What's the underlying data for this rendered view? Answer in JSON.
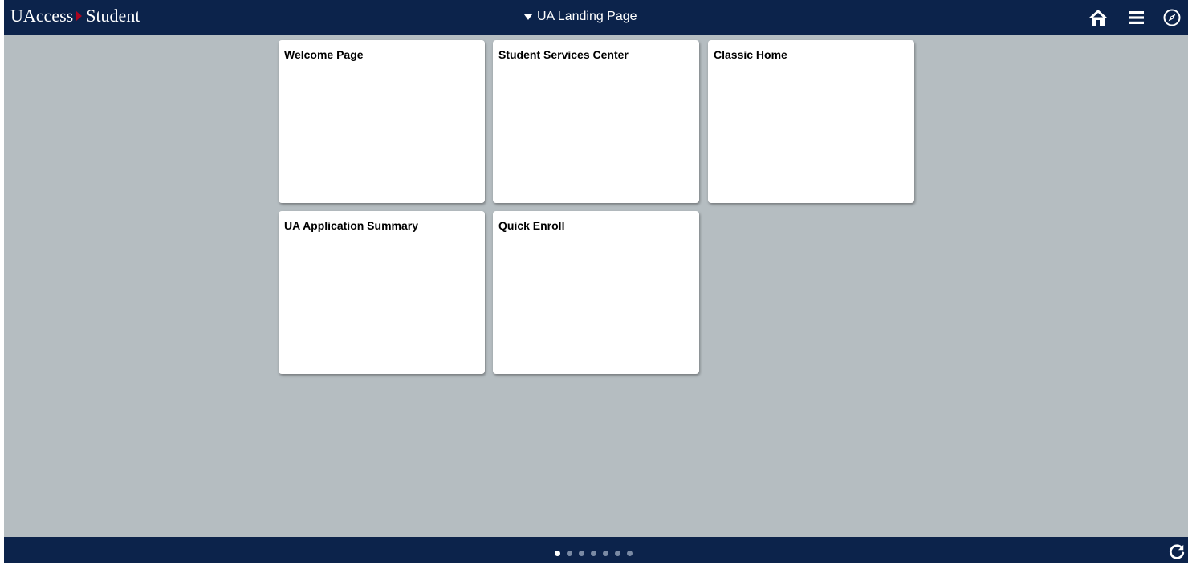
{
  "header": {
    "brand_part1": "UAccess",
    "brand_part2": "Student",
    "page_title": "UA Landing Page",
    "icons": [
      "home-icon",
      "menu-icon",
      "compass-icon"
    ]
  },
  "tiles": [
    {
      "title": "Welcome Page"
    },
    {
      "title": "Student Services Center"
    },
    {
      "title": "Classic Home"
    },
    {
      "title": "UA Application Summary"
    },
    {
      "title": "Quick Enroll"
    }
  ],
  "footer": {
    "page_dots_total": 7,
    "active_page": 1,
    "refresh_icon": "refresh-icon"
  },
  "colors": {
    "header_bg": "#0c234b",
    "brand_arrow": "#ab0520",
    "page_bg": "#b5bdc1",
    "tile_bg": "#ffffff"
  }
}
